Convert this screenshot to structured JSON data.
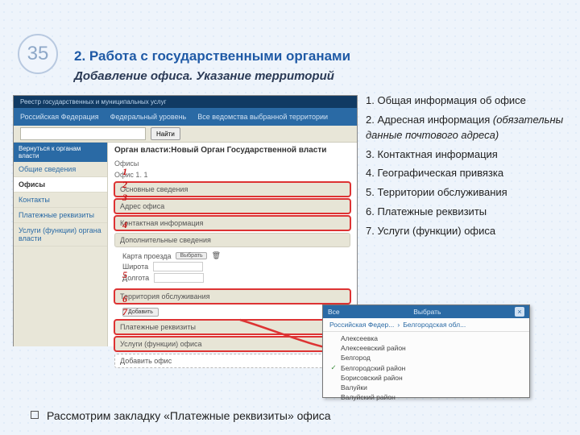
{
  "page_number": "35",
  "title_main": "2. Работа с государственными органами",
  "title_sub": "Добавление офиса. Указание территорий",
  "legend": {
    "i1": "1. Общая информация об офисе",
    "i2a": "2. Адресная информация",
    "i2b": "(обязательны данные почтового адреса)",
    "i3": "3. Контактная информация",
    "i4": "4. Географическая привязка",
    "i5": "5. Территории обслуживания",
    "i6": "6. Платежные реквизиты",
    "i7": "7. Услуги (функции) офиса"
  },
  "bullet": "Рассмотрим закладку «Платежные реквизиты» офиса",
  "app": {
    "logotext": "Реестр государственных и муниципальных услуг",
    "topbar": {
      "a": "Российская Федерация",
      "b": "Федеральный уровень",
      "c": "Все ведомства выбранной территории"
    },
    "search_btn": "Найти",
    "backlink": "Вернуться к органам власти",
    "side": {
      "s1": "Общие сведения",
      "s2": "Офисы",
      "s3": "Контакты",
      "s4": "Платежные реквизиты",
      "s5": "Услуги (функции) органа власти"
    },
    "main_title": "Орган власти:Новый Орган Государственной власти",
    "sub_title": "Офисы",
    "office_label": "Офис 1. 1",
    "tabs": {
      "t1": "Основные сведения",
      "t2": "Адрес офиса",
      "t3": "Контактная информация",
      "t4": "Дополнительные сведения",
      "t4_map": "Карта проезда",
      "t4_select": "Выбрать",
      "t4_lat": "Широта",
      "t4_lon": "Долгота",
      "t5": "Территория обслуживания",
      "t5_add": "Добавить",
      "t6": "Платежные реквизиты",
      "t7": "Услуги (функции) офиса",
      "t_addoffice": "Добавить офис"
    }
  },
  "red_idx": {
    "n1": "1",
    "n2": "2",
    "n3": "3",
    "n4": "4",
    "n5": "5",
    "n6": "6",
    "n7": "7"
  },
  "popup": {
    "bar_a": "Все",
    "crumb_a": "Российская Федер...",
    "crumb_sep": "›",
    "crumb_b": "Белгородская обл...",
    "save": "Выбрать",
    "items": {
      "p1": "Алексеевка",
      "p2": "Алексеевский район",
      "p3": "Белгород",
      "p4": "Белгородский район",
      "p5": "Борисовский район",
      "p6": "Валуйки",
      "p7": "Валуйский район"
    },
    "checked_index": 3
  }
}
